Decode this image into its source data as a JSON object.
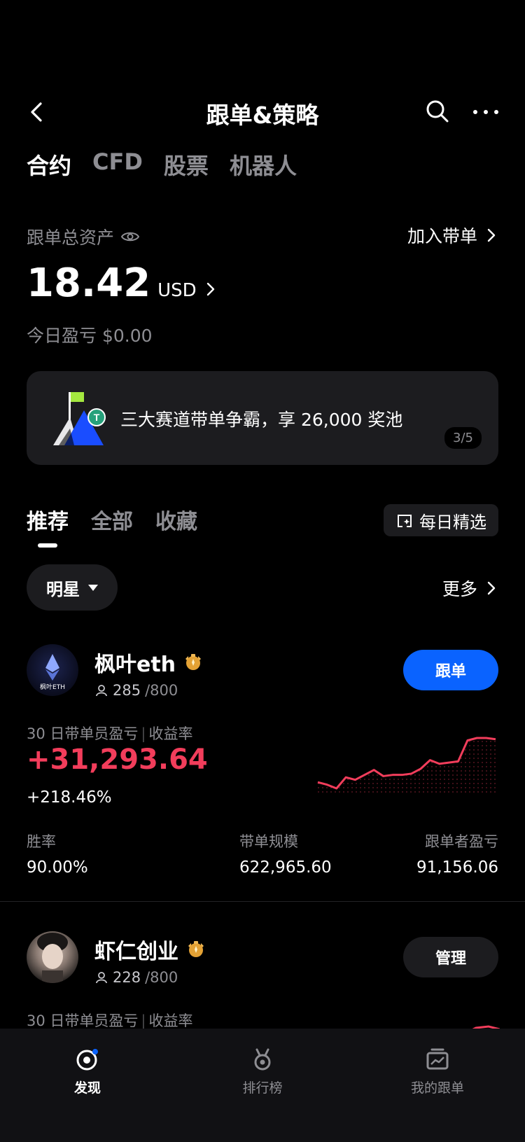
{
  "header": {
    "title": "跟单&策略"
  },
  "top_tabs": [
    "合约",
    "CFD",
    "股票",
    "机器人"
  ],
  "assets": {
    "label": "跟单总资产",
    "join_label": "加入带单",
    "balance": "18.42",
    "currency": "USD",
    "today_label": "今日盈亏",
    "today_value": "$0.00"
  },
  "banner": {
    "text": "三大赛道带单争霸，享 26,000 奖池",
    "pager": "3/5"
  },
  "sub_tabs": [
    "推荐",
    "全部",
    "收藏"
  ],
  "daily_label": "每日精选",
  "filter": {
    "selected": "明星",
    "more_label": "更多"
  },
  "traders": [
    {
      "name": "枫叶eth",
      "avatar_text": "枫叶ETH",
      "followers": "285",
      "followers_max": "/800",
      "button": "跟单",
      "pl_label": "30 日带单员盈亏",
      "rate_label": "收益率",
      "pl": "+31,293.64",
      "rate": "+218.46%",
      "stats": [
        {
          "k": "胜率",
          "v": "90.00%"
        },
        {
          "k": "带单规模",
          "v": "622,965.60"
        },
        {
          "k": "跟单者盈亏",
          "v": "91,156.06"
        }
      ],
      "sparkline": [
        8,
        6,
        3,
        12,
        10,
        14,
        18,
        13,
        14,
        14,
        15,
        19,
        26,
        23,
        24,
        25,
        42,
        44,
        44,
        43
      ]
    },
    {
      "name": "虾仁创业",
      "followers": "228",
      "followers_max": "/800",
      "button": "管理",
      "pl_label": "30 日带单员盈亏",
      "rate_label": "收益率"
    }
  ],
  "bottom_nav": [
    {
      "label": "发现",
      "active": true
    },
    {
      "label": "排行榜",
      "active": false
    },
    {
      "label": "我的跟单",
      "active": false
    }
  ],
  "colors": {
    "accent_blue": "#0a63ff",
    "profit_red": "#f23d5b",
    "card_bg": "#1c1c1f"
  }
}
